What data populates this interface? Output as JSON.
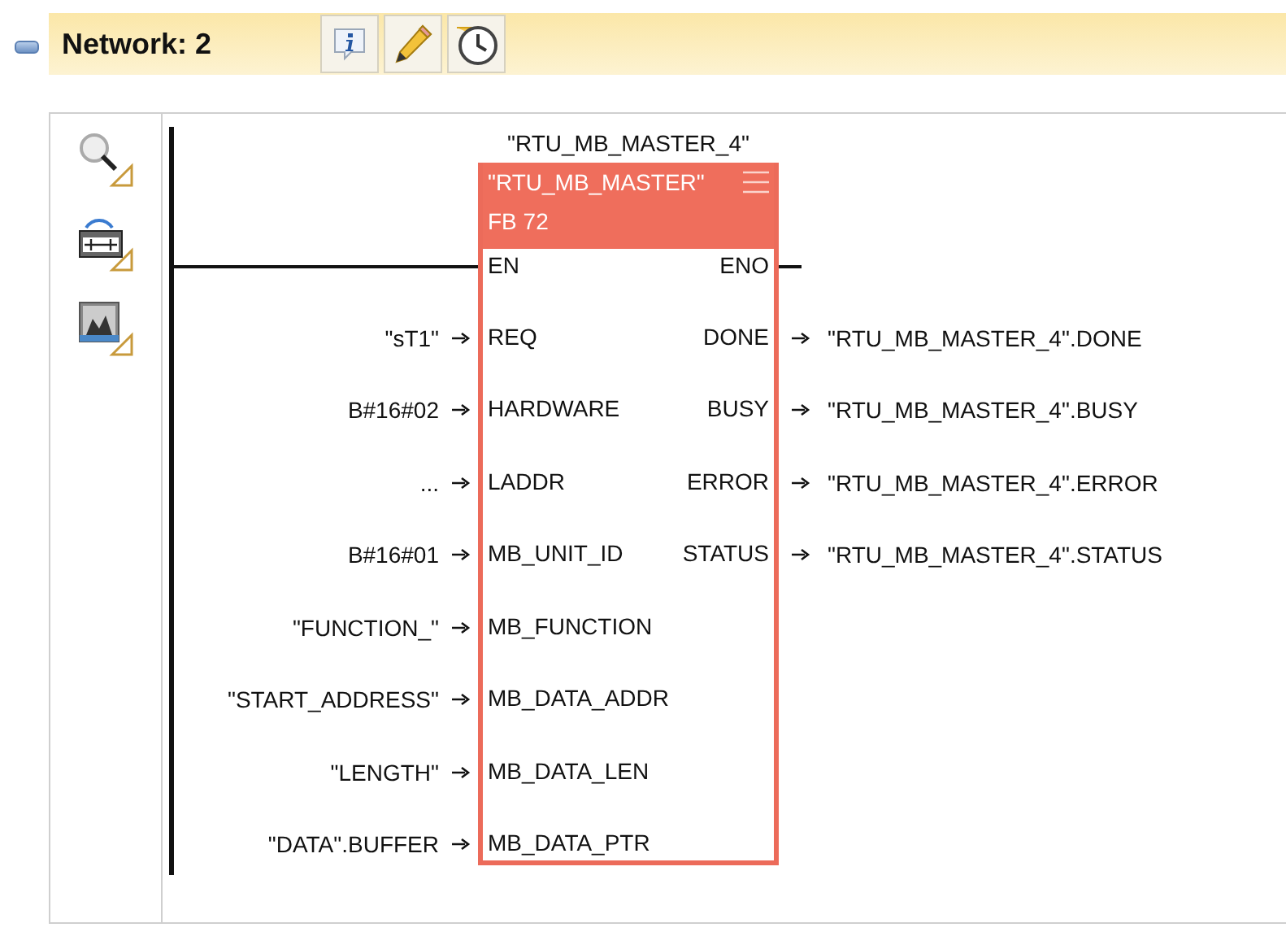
{
  "network": {
    "title": "Network: 2",
    "collapsed": false
  },
  "block": {
    "instance": "\"RTU_MB_MASTER_4\"",
    "name": "\"RTU_MB_MASTER\"",
    "number": "FB 72",
    "en": "EN",
    "eno": "ENO",
    "pins": [
      {
        "input_value": "\"sT1\"",
        "input_param": "REQ",
        "output_param": "DONE",
        "output_value": "\"RTU_MB_MASTER_4\".DONE"
      },
      {
        "input_value": "B#16#02",
        "input_param": "HARDWARE",
        "output_param": "BUSY",
        "output_value": "\"RTU_MB_MASTER_4\".BUSY"
      },
      {
        "input_value": "...",
        "input_param": "LADDR",
        "output_param": "ERROR",
        "output_value": "\"RTU_MB_MASTER_4\".ERROR"
      },
      {
        "input_value": "B#16#01",
        "input_param": "MB_UNIT_ID",
        "output_param": "STATUS",
        "output_value": "\"RTU_MB_MASTER_4\".STATUS"
      },
      {
        "input_value": "\"FUNCTION_\"",
        "input_param": "MB_FUNCTION"
      },
      {
        "input_value": "\"START_ADDRESS\"",
        "input_param": "MB_DATA_ADDR"
      },
      {
        "input_value": "\"LENGTH\"",
        "input_param": "MB_DATA_LEN"
      },
      {
        "input_value": "\"DATA\".BUFFER",
        "input_param": "MB_DATA_PTR"
      }
    ]
  }
}
